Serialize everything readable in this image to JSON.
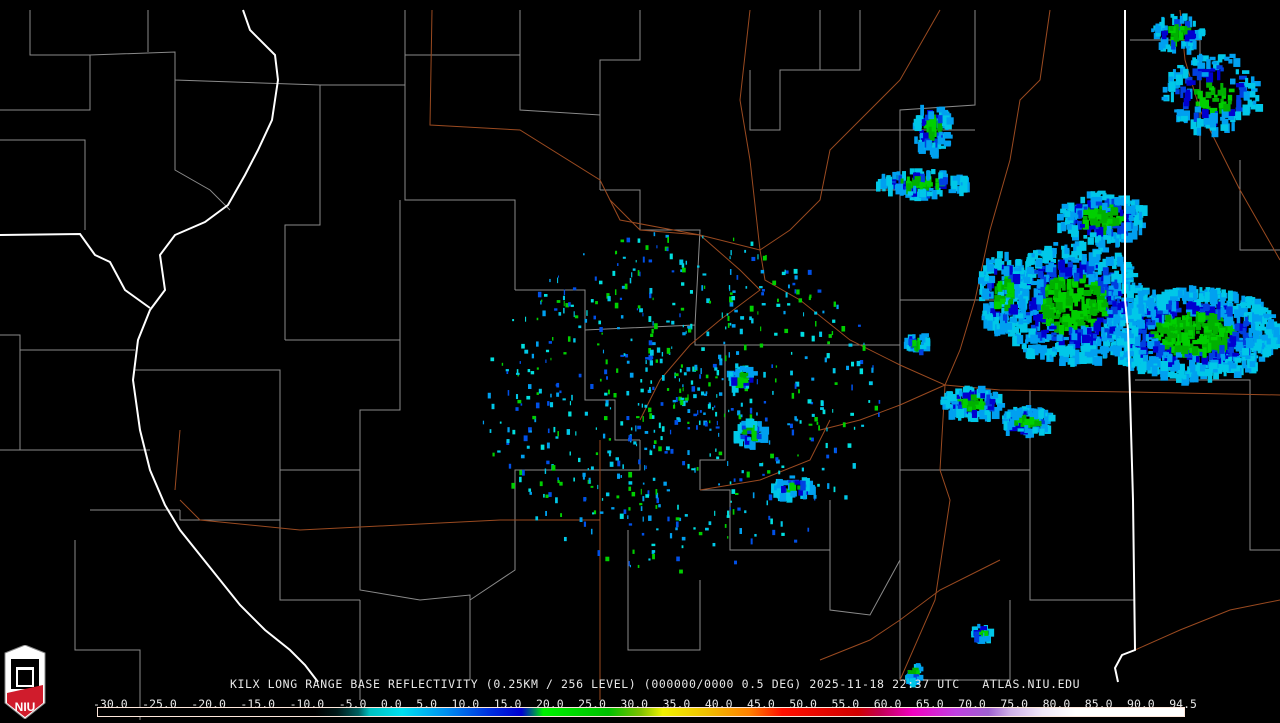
{
  "product_title": "KILX LONG RANGE BASE REFLECTIVITY (0.25KM / 256 LEVEL) (000000/0000 0.5 DEG) 2025-11-18 22:37 UTC   ATLAS.NIU.EDU",
  "legend": {
    "unit_labels": [
      "-30.0",
      "-25.0",
      "-20.0",
      "-15.0",
      "-10.0",
      "-5.0",
      "0.0",
      "5.0",
      "10.0",
      "15.0",
      "20.0",
      "25.0",
      "30.0",
      "35.0",
      "40.0",
      "45.0",
      "50.0",
      "55.0",
      "60.0",
      "65.0",
      "70.0",
      "75.0",
      "80.0",
      "85.0",
      "90.0",
      "94.5"
    ]
  },
  "logo": {
    "text": "NIU"
  },
  "colors": {
    "state_border": "#ffffff",
    "county": "#8a8a8a",
    "highway": "#9a4a20",
    "background": "#000000"
  }
}
